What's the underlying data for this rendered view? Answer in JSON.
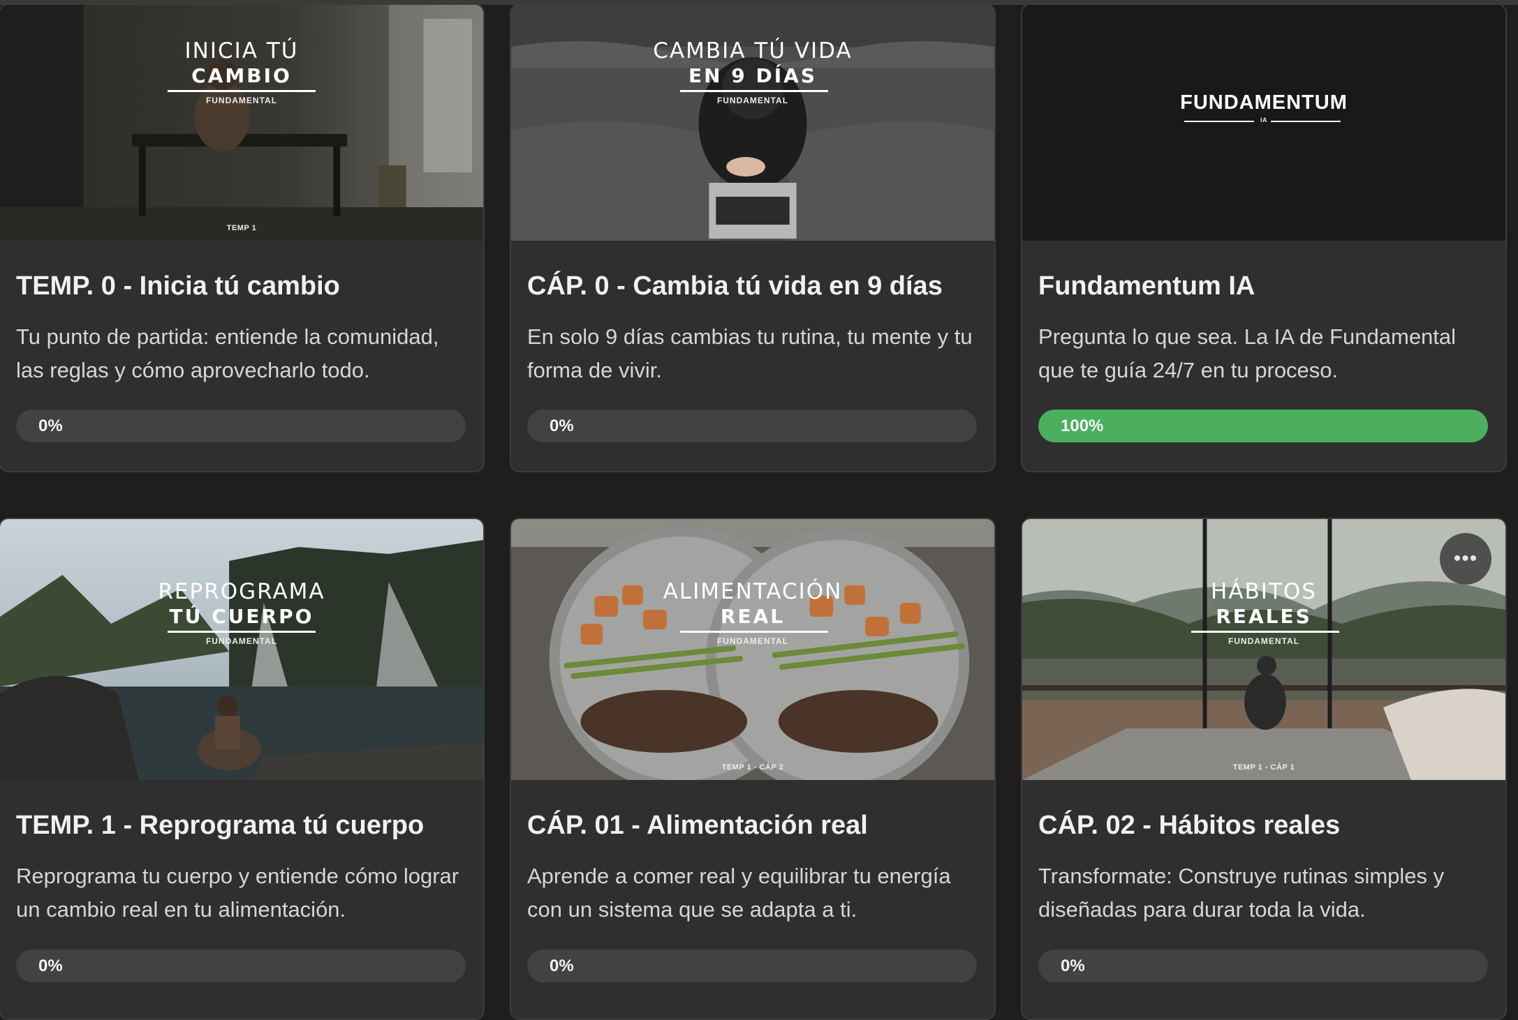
{
  "accent": {
    "progress_complete": "#4caf5f",
    "progress_track": "#424242"
  },
  "cards": [
    {
      "title": "TEMP. 0 - Inicia tú cambio",
      "description": "Tu punto de partida: entiende la comunidad, las reglas y cómo aprovecharlo todo.",
      "progress_label": "0%",
      "progress": 0,
      "thumb_line1": "INICIA TÚ",
      "thumb_line2": "CAMBIO",
      "thumb_brand": "FUNDAMENTAL",
      "thumb_tag": "TEMP 1"
    },
    {
      "title": "CÁP. 0 - Cambia tú vida en 9 días",
      "description": "En solo 9 días cambias tu rutina, tu mente y tu forma de vivir.",
      "progress_label": "0%",
      "progress": 0,
      "thumb_line1": "CAMBIA TÚ VIDA",
      "thumb_line2": "EN 9 DÍAS",
      "thumb_brand": "FUNDAMENTAL",
      "thumb_tag": ""
    },
    {
      "title": "Fundamentum IA",
      "description": "Pregunta lo que sea. La IA de Fundamental que te guía 24/7 en tu proceso.",
      "progress_label": "100%",
      "progress": 100,
      "thumb_logo": "FUNDAMENTUM",
      "thumb_logo_sub": "IA"
    },
    {
      "title": "TEMP. 1 - Reprograma tú cuerpo",
      "description": "Reprograma tu cuerpo y entiende cómo lograr un cambio real en tu alimentación.",
      "progress_label": "0%",
      "progress": 0,
      "thumb_line1": "REPROGRAMA",
      "thumb_line2": "TÚ CUERPO",
      "thumb_brand": "FUNDAMENTAL",
      "thumb_tag": ""
    },
    {
      "title": "CÁP. 01 - Alimentación real",
      "description": "Aprende a comer real y equilibrar tu energía con un sistema que se adapta a ti.",
      "progress_label": "0%",
      "progress": 0,
      "thumb_line1": "ALIMENTACIÓN",
      "thumb_line2": "REAL",
      "thumb_brand": "FUNDAMENTAL",
      "thumb_tag": "TEMP 1 - CÁP 2"
    },
    {
      "title": "CÁP. 02 - Hábitos reales",
      "description": "Transformate: Construye rutinas simples y diseñadas para durar toda la vida.",
      "progress_label": "0%",
      "progress": 0,
      "thumb_line1": "HÁBITOS",
      "thumb_line2": "REALES",
      "thumb_brand": "FUNDAMENTAL",
      "thumb_tag": "TEMP 1 - CÁP 1",
      "more_icon": "•••"
    }
  ]
}
